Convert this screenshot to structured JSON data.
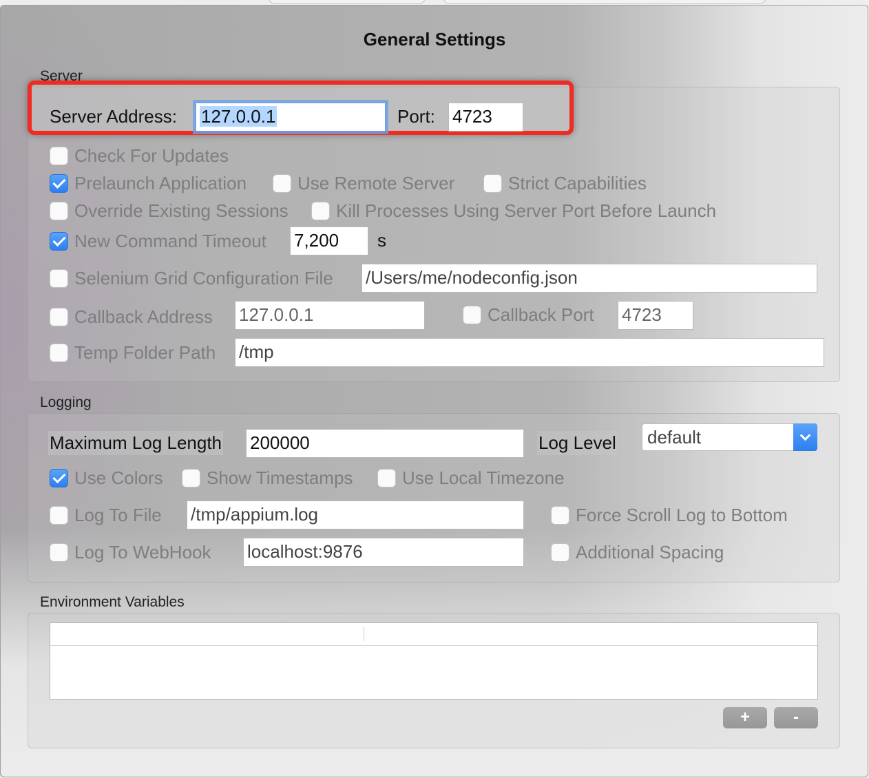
{
  "window": {
    "title": "General Settings"
  },
  "server": {
    "section_label": "Server",
    "address_label": "Server Address:",
    "address_value": "127.0.0.1",
    "port_label": "Port:",
    "port_value": "4723",
    "check_for_updates": {
      "label": "Check For Updates",
      "checked": false
    },
    "prelaunch_application": {
      "label": "Prelaunch Application",
      "checked": true
    },
    "use_remote_server": {
      "label": "Use Remote Server",
      "checked": false
    },
    "strict_capabilities": {
      "label": "Strict Capabilities",
      "checked": false
    },
    "override_existing_sessions": {
      "label": "Override Existing Sessions",
      "checked": false
    },
    "kill_processes": {
      "label": "Kill Processes Using Server Port Before Launch",
      "checked": false
    },
    "new_command_timeout": {
      "label": "New Command Timeout",
      "checked": true,
      "value": "7,200",
      "unit": "s"
    },
    "selenium_grid": {
      "label": "Selenium Grid Configuration File",
      "checked": false,
      "value": "/Users/me/nodeconfig.json"
    },
    "callback_address": {
      "label": "Callback Address",
      "checked": false,
      "value": "127.0.0.1"
    },
    "callback_port": {
      "label": "Callback Port",
      "checked": false,
      "value": "4723"
    },
    "temp_folder_path": {
      "label": "Temp Folder Path",
      "checked": false,
      "value": "/tmp"
    }
  },
  "logging": {
    "section_label": "Logging",
    "max_log_length_label": "Maximum Log Length",
    "max_log_length_value": "200000",
    "log_level_label": "Log Level",
    "log_level_value": "default",
    "use_colors": {
      "label": "Use Colors",
      "checked": true
    },
    "show_timestamps": {
      "label": "Show Timestamps",
      "checked": false
    },
    "use_local_timezone": {
      "label": "Use Local Timezone",
      "checked": false
    },
    "log_to_file": {
      "label": "Log To File",
      "checked": false,
      "value": "/tmp/appium.log"
    },
    "force_scroll": {
      "label": "Force Scroll Log to Bottom",
      "checked": false
    },
    "log_to_webhook": {
      "label": "Log To WebHook",
      "checked": false,
      "value": "localhost:9876"
    },
    "additional_spacing": {
      "label": "Additional Spacing",
      "checked": false
    }
  },
  "environment": {
    "section_label": "Environment Variables",
    "add_label": "+",
    "remove_label": "-"
  },
  "colors": {
    "highlight": "#f02b21",
    "accent": "#2c7ff0"
  }
}
